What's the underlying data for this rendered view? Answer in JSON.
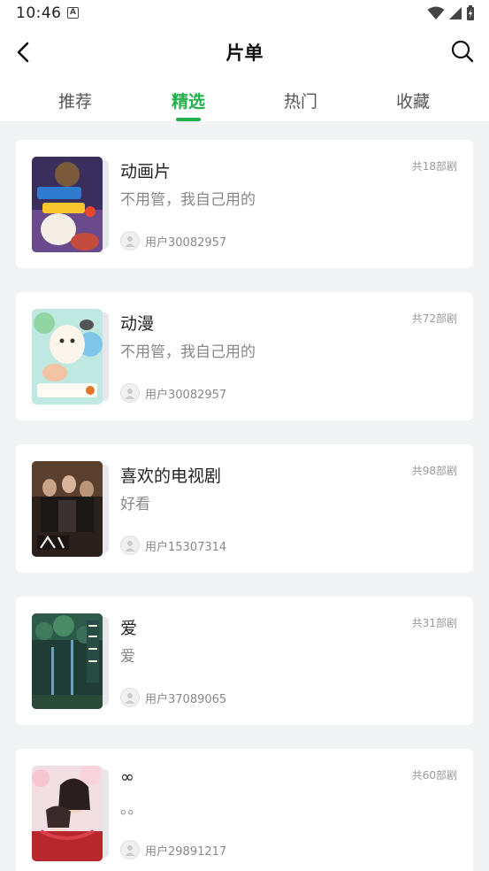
{
  "status_bar": {
    "time": "10:46",
    "indicator": "A"
  },
  "header": {
    "title": "片单",
    "back_icon": "chevron-left-icon",
    "search_icon": "search-icon"
  },
  "tabs": [
    {
      "label": "推荐",
      "active": false
    },
    {
      "label": "精选",
      "active": true
    },
    {
      "label": "热门",
      "active": false
    },
    {
      "label": "收藏",
      "active": false
    }
  ],
  "colors": {
    "accent": "#21b04b",
    "background": "#f2f3f5"
  },
  "playlists": [
    {
      "title": "动画片",
      "description": "不用管，我自己用的",
      "count": "共18部剧",
      "user": "用户30082957"
    },
    {
      "title": "动漫",
      "description": "不用管，我自己用的",
      "count": "共72部剧",
      "user": "用户30082957"
    },
    {
      "title": "喜欢的电视剧",
      "description": "好看",
      "count": "共98部剧",
      "user": "用户15307314"
    },
    {
      "title": "爱",
      "description": "爱",
      "count": "共31部剧",
      "user": "用户37089065"
    },
    {
      "title": "∞",
      "description": "。。",
      "count": "共60部剧",
      "user": "用户29891217"
    }
  ]
}
